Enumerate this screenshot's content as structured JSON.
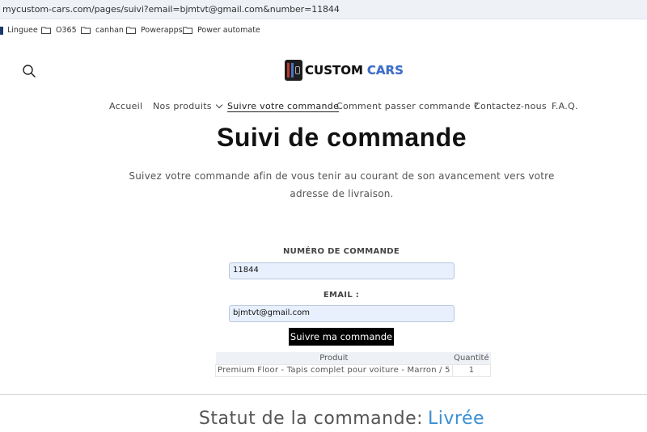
{
  "browser": {
    "url": "mycustom-cars.com/pages/suivi?email=bjmtvt@gmail.com&number=11844",
    "bookmarks": [
      "Linguee",
      "O365",
      "canhan",
      "Powerapps",
      "Power automate"
    ]
  },
  "header": {
    "logo_text_1": "CUSTOM",
    "logo_text_2": "CARS"
  },
  "nav": {
    "items": [
      "Accueil",
      "Nos produits",
      "Suivre votre commande",
      "Comment passer commande ?",
      "Contactez-nous",
      "F.A.Q."
    ]
  },
  "page": {
    "title": "Suivi de commande",
    "description": "Suivez votre commande afin de vous tenir au courant de son avancement vers votre adresse de livraison."
  },
  "form": {
    "order_label": "NUMÉRO DE COMMANDE",
    "order_value": "11844",
    "email_label": "EMAIL :",
    "email_value": "bjmtvt@gmail.com",
    "submit_label": "Suivre ma commande"
  },
  "items_table": {
    "headers": [
      "Produit",
      "Quantité"
    ],
    "rows": [
      {
        "product": "Premium Floor - Tapis complet pour voiture - Marron / 5",
        "quantity": "1"
      }
    ]
  },
  "status": {
    "label": "Statut de la commande:",
    "value": "Livrée"
  },
  "colors": {
    "status_value": "#3a8fd6",
    "logo_accent": "#3b6fcf",
    "submit_bg": "#000000"
  }
}
